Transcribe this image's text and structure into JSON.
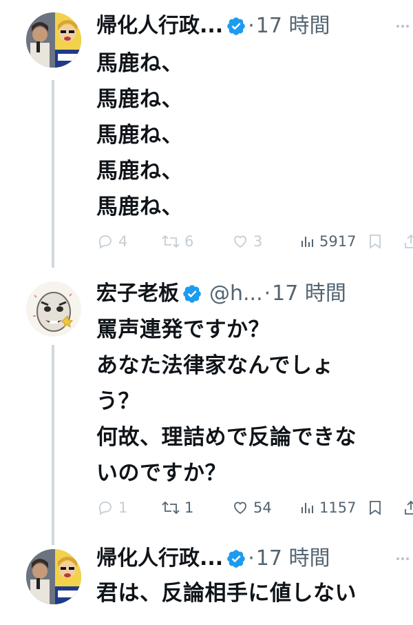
{
  "thread": [
    {
      "author": {
        "display_name": "帰化人行政...",
        "handle": "",
        "verified": true,
        "avatar": "photo-avatar-woman-poster"
      },
      "separator": "·",
      "time": "17 時間",
      "lines": [
        "馬鹿ね、",
        "馬鹿ね、",
        "馬鹿ね、",
        "馬鹿ね、",
        "馬鹿ね、"
      ],
      "stats": {
        "replies": "4",
        "retweets": "6",
        "likes": "3",
        "views": "5917"
      }
    },
    {
      "author": {
        "display_name": "宏子老板",
        "handle": "@h...",
        "verified": true,
        "avatar": "meme-face-avatar"
      },
      "separator": "·",
      "time": "17 時間",
      "lines": [
        "罵声連発ですか？",
        "あなた法律家なんでしょ",
        "う？",
        "何故、理詰めで反論できな",
        "いのですか？"
      ],
      "stats": {
        "replies": "1",
        "retweets": "1",
        "likes": "54",
        "views": "1157"
      }
    },
    {
      "author": {
        "display_name": "帰化人行政...",
        "handle": "",
        "verified": true,
        "avatar": "photo-avatar-woman-poster"
      },
      "separator": "·",
      "time": "17 時間",
      "lines": [
        "君は、反論相手に値しない"
      ]
    }
  ],
  "icons": {
    "verified": "verified-badge-icon",
    "reply": "reply-icon",
    "retweet": "retweet-icon",
    "like": "heart-icon",
    "views": "views-icon",
    "bookmark": "bookmark-icon",
    "share": "share-icon",
    "more": "more-icon"
  },
  "colors": {
    "verified": "#1d9bf0",
    "text": "#0f1419",
    "secondary": "#536471",
    "faint": "#c4cdd4",
    "thread_line": "#cfd9de"
  }
}
